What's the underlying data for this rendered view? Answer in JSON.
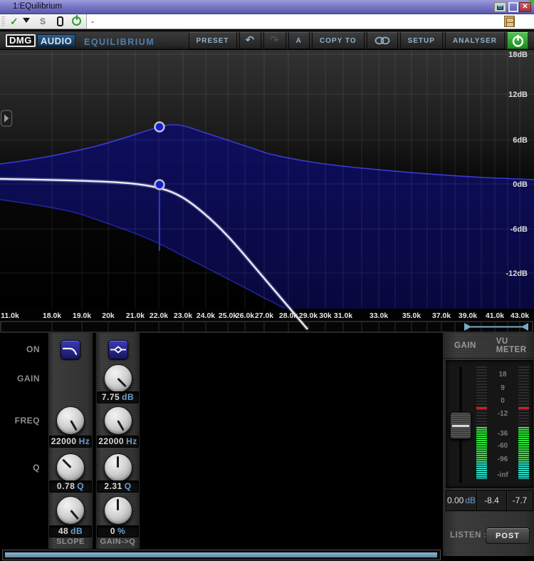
{
  "window": {
    "title": "1:EQuilibrium"
  },
  "host_toolbar": {
    "s_label": "S",
    "field_value": "-"
  },
  "header": {
    "dmg": "DMG",
    "audio": "AUDIO",
    "product": "EQUILIBRIUM",
    "preset": "PRESET",
    "undo": "↶",
    "redo": "↷",
    "a": "A",
    "copy_to": "COPY TO",
    "setup": "SETUP",
    "analyser": "ANALYSER"
  },
  "graph": {
    "db_ticks": [
      "18dB",
      "12dB",
      "6dB",
      "0dB",
      "-6dB",
      "-12dB"
    ],
    "freq_ticks": [
      "11.0k",
      "18.0k",
      "19.0k",
      "20k",
      "21.0k",
      "22.0k",
      "23.0k",
      "24.0k",
      "25.0k",
      "26.0k",
      "27.0k",
      "28.0k",
      "29.0k",
      "30k",
      "31.0k",
      "33.0k",
      "35.0k",
      "37.0k",
      "39.0k",
      "41.0k",
      "43.0k"
    ]
  },
  "controls": {
    "rows": [
      "ON",
      "GAIN",
      "FREQ",
      "Q"
    ],
    "band1": {
      "freq": "22000",
      "freq_unit": "Hz",
      "q": "0.78",
      "q_unit": "Q",
      "slope": "48",
      "slope_unit": "dB",
      "footer": "SLOPE"
    },
    "band2": {
      "gain": "7.75",
      "gain_unit": "dB",
      "freq": "22000",
      "freq_unit": "Hz",
      "q": "2.31",
      "q_unit": "Q",
      "gainq": "0",
      "gainq_unit": "%",
      "footer": "GAIN->Q"
    }
  },
  "meter": {
    "tab_gain": "GAIN",
    "tab_vu": "VU METER",
    "scale": [
      "18",
      "9",
      "0",
      "-12",
      "-36",
      "-60",
      "-96",
      "-inf"
    ],
    "gain_readout": "0.00",
    "gain_unit": "dB",
    "peak_left": "-8.4",
    "peak_right": "-7.7",
    "listen": "LISTEN :",
    "post": "POST"
  },
  "accent_colors": {
    "fill_navy": "#0c0c52",
    "curve_white": "#f0f0f5",
    "node_blue": "#1520cc",
    "unit_blue": "#6d9fd0"
  }
}
